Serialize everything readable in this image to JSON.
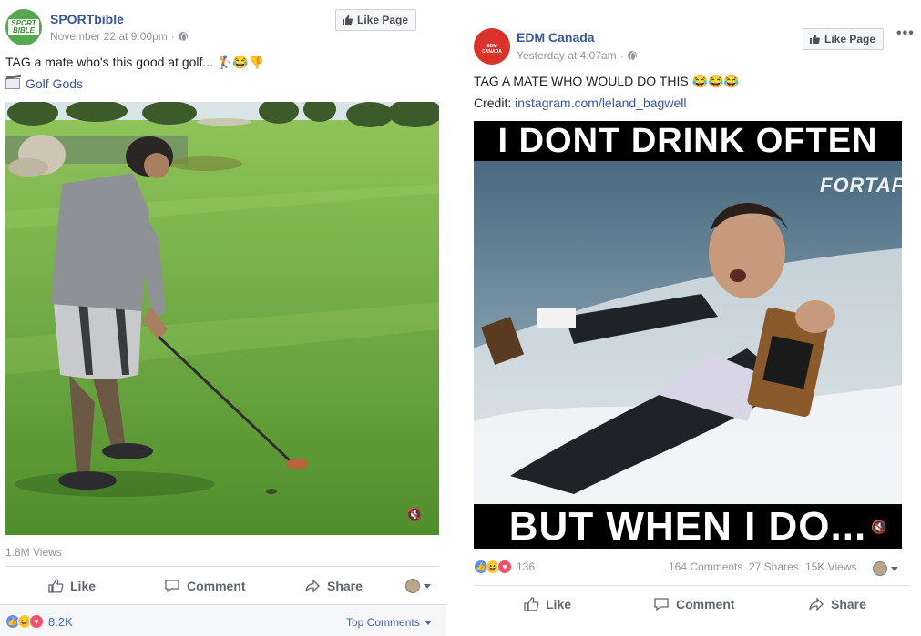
{
  "left_post": {
    "page_name": "SPORTbible",
    "avatar_text": "SPORT BIBLE",
    "timestamp": "November 22 at 9:00pm",
    "like_page_label": "Like Page",
    "caption": "TAG a mate who's this good at golf... 🏌😂👎",
    "tag_link": "Golf Gods",
    "views": "1.8M Views",
    "actions": {
      "like": "Like",
      "comment": "Comment",
      "share": "Share"
    },
    "reaction_count": "8.2K",
    "top_comments": "Top Comments",
    "colors": {
      "grass": "#6fa83a",
      "sky": "#dfe8ec",
      "accent": "#4267b2"
    }
  },
  "right_post": {
    "page_name": "EDM Canada",
    "avatar_text": "EDM CANADA",
    "timestamp": "Yesterday at 4:07am",
    "like_page_label": "Like Page",
    "more_label": "•••",
    "caption": "TAG A MATE WHO WOULD DO THIS 😂😂😂",
    "credit_label": "Credit:",
    "credit_link": "instagram.com/leland_bagwell",
    "meme_top": "I DONT DRINK OFTEN",
    "meme_bottom": "BUT WHEN I DO...",
    "watermark": "FORTAFY",
    "reaction_count": "136",
    "comments": "164 Comments",
    "shares": "27 Shares",
    "views": "15K Views",
    "actions": {
      "like": "Like",
      "comment": "Comment",
      "share": "Share"
    },
    "colors": {
      "water": "#5f7f93",
      "brand_red": "#d9332b"
    }
  }
}
